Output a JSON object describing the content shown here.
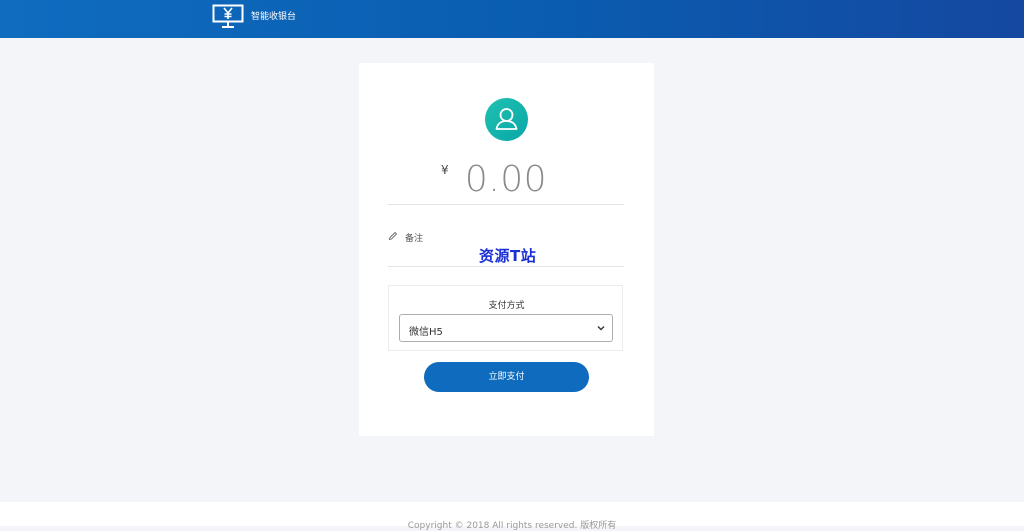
{
  "header": {
    "title": "智能收银台",
    "logo_icon": "cashier-monitor-icon"
  },
  "payment": {
    "currency_symbol": "¥",
    "amount": "0.00",
    "remark_label": "备注",
    "watermark_text": "资源T站",
    "method_label": "支付方式",
    "method_selected": "微信H5",
    "submit_label": "立即支付"
  },
  "footer": {
    "copyright": "Copyright © 2018 All rights reserved. 版权所有"
  },
  "colors": {
    "header_start": "#0f6cbf",
    "header_end": "#1548a0",
    "avatar": "#12b5ab",
    "button": "#0f6bbd",
    "watermark": "#1a2fd6"
  }
}
